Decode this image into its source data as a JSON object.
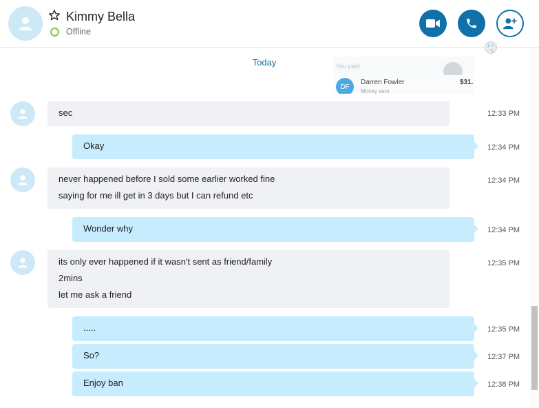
{
  "header": {
    "contact_name": "Kimmy Bella",
    "presence": "Offline",
    "favorite_icon": "star-outline-icon",
    "buttons": [
      {
        "icon": "video-camera-icon"
      },
      {
        "icon": "phone-icon"
      },
      {
        "icon": "add-person-icon"
      }
    ]
  },
  "conversation": {
    "date_separator": "Today",
    "payment_preview": {
      "initials": "DF",
      "payee": "Darren Fowler",
      "status": "Money sent",
      "amount": "$31.",
      "faded_label": "You paid"
    },
    "messages": [
      {
        "direction": "in",
        "lines": [
          "sec"
        ],
        "time": "12:33 PM"
      },
      {
        "direction": "out",
        "lines": [
          "Okay"
        ],
        "time": "12:34 PM"
      },
      {
        "direction": "in",
        "lines": [
          "never happened before I sold some earlier worked fine",
          "saying for me ill get in 3 days but I can refund etc"
        ],
        "time": "12:34 PM"
      },
      {
        "direction": "out",
        "lines": [
          "Wonder why"
        ],
        "time": "12:34 PM"
      },
      {
        "direction": "in",
        "lines": [
          "its only ever happened if it wasn't sent as friend/family",
          "2mins",
          "let me ask a friend"
        ],
        "time": "12:35 PM"
      },
      {
        "direction": "out",
        "lines": [
          "....."
        ],
        "time": "12:35 PM"
      },
      {
        "direction": "out",
        "lines": [
          "So?"
        ],
        "time": "12:37 PM"
      },
      {
        "direction": "out",
        "lines": [
          "Enjoy ban"
        ],
        "time": "12:38 PM"
      }
    ]
  },
  "colors": {
    "accent": "#0f71a8",
    "incoming_bubble": "#eff1f4",
    "outgoing_bubble": "#c7ecfd",
    "avatar_bg": "#cde8f7",
    "presence_offline": "#8bc34a"
  }
}
